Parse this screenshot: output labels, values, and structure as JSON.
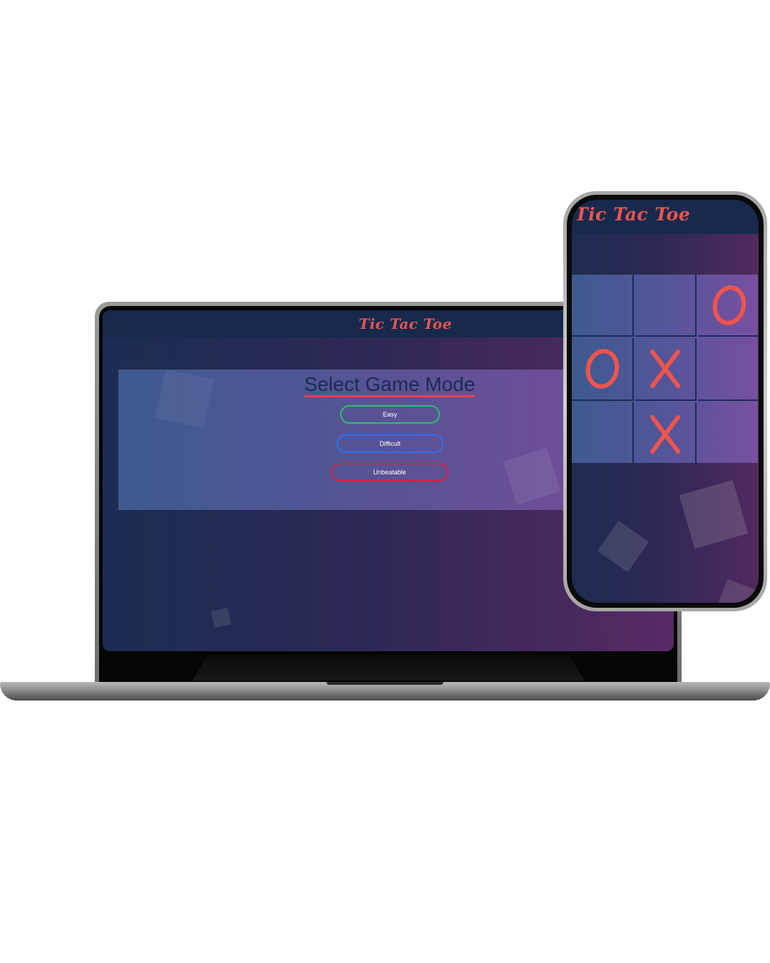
{
  "app": {
    "title": "Tic Tac Toe"
  },
  "laptop": {
    "header_title": "Tic Tac Toe",
    "mode_panel": {
      "title": "Select Game Mode",
      "buttons": {
        "easy": "Easy",
        "difficult": "Difficult",
        "unbeatable": "Unbeatable"
      }
    }
  },
  "phone": {
    "header_title": "Tic Tac Toe",
    "board": [
      "",
      "",
      "O",
      "O",
      "X",
      "",
      "",
      "X",
      ""
    ]
  },
  "colors": {
    "accent": "#f0544d",
    "header_bg": "#172a4e",
    "easy_border": "#2bbf6c",
    "difficult_border": "#2d6ef0",
    "unbeatable_border": "#d8203a",
    "mark_color": "#f0544d"
  }
}
